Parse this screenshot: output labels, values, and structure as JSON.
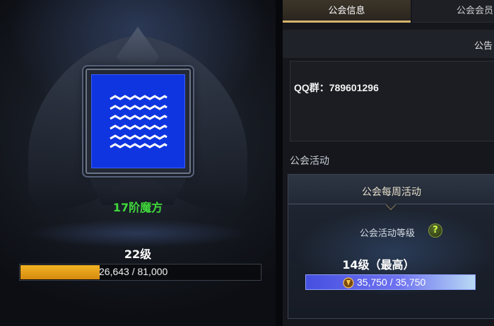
{
  "guild": {
    "name": "17阶魔方",
    "level_label": "22级",
    "xp_text": "26,643 / 81,000",
    "xp_progress": 0.329,
    "banner_color": "#0f35e0",
    "banner_icon": "waves-icon"
  },
  "tabs": [
    {
      "label": "公会信息",
      "active": true
    },
    {
      "label": "公会会员",
      "active": false
    }
  ],
  "notice": {
    "title": "公告",
    "text": "QQ群：789601296"
  },
  "activity": {
    "section_label": "公会活动",
    "weekly_title": "公会每周活动",
    "level_label": "公会活动等级",
    "help_icon": "?",
    "level_value": "14级（最高）",
    "points_text": "35,750 / 35,750",
    "points_progress": 1.0
  },
  "colors": {
    "accent_gold": "#d5b470",
    "guild_name_green": "#3fd83a",
    "xp_orange": "#f3b323",
    "activity_blue": "#4650e0"
  }
}
